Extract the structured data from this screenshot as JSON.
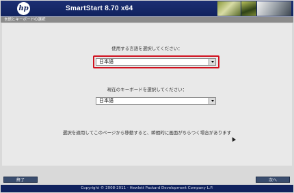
{
  "header": {
    "logo_text": "hp",
    "title": "SmartStart 8.70 x64"
  },
  "section": {
    "title": "言語とキーボードの選択"
  },
  "language": {
    "prompt": "使用する言語を選択してください：",
    "selected": "日本語"
  },
  "keyboard": {
    "prompt": "現在のキーボードを選択してください：",
    "selected": "日本語"
  },
  "notice": "選択を適用してこのページから移動すると、瞬間的に画面がちらつく場合があります",
  "buttons": {
    "exit_label": "終了",
    "next_label": "次へ"
  },
  "footer": {
    "copyright": "Copyright © 2008-2011 - Hewlett Packard Development Company L.P."
  },
  "colors": {
    "header_bg": "#10225e",
    "highlight": "#d0101e",
    "button_bg": "#3a4d6e"
  }
}
